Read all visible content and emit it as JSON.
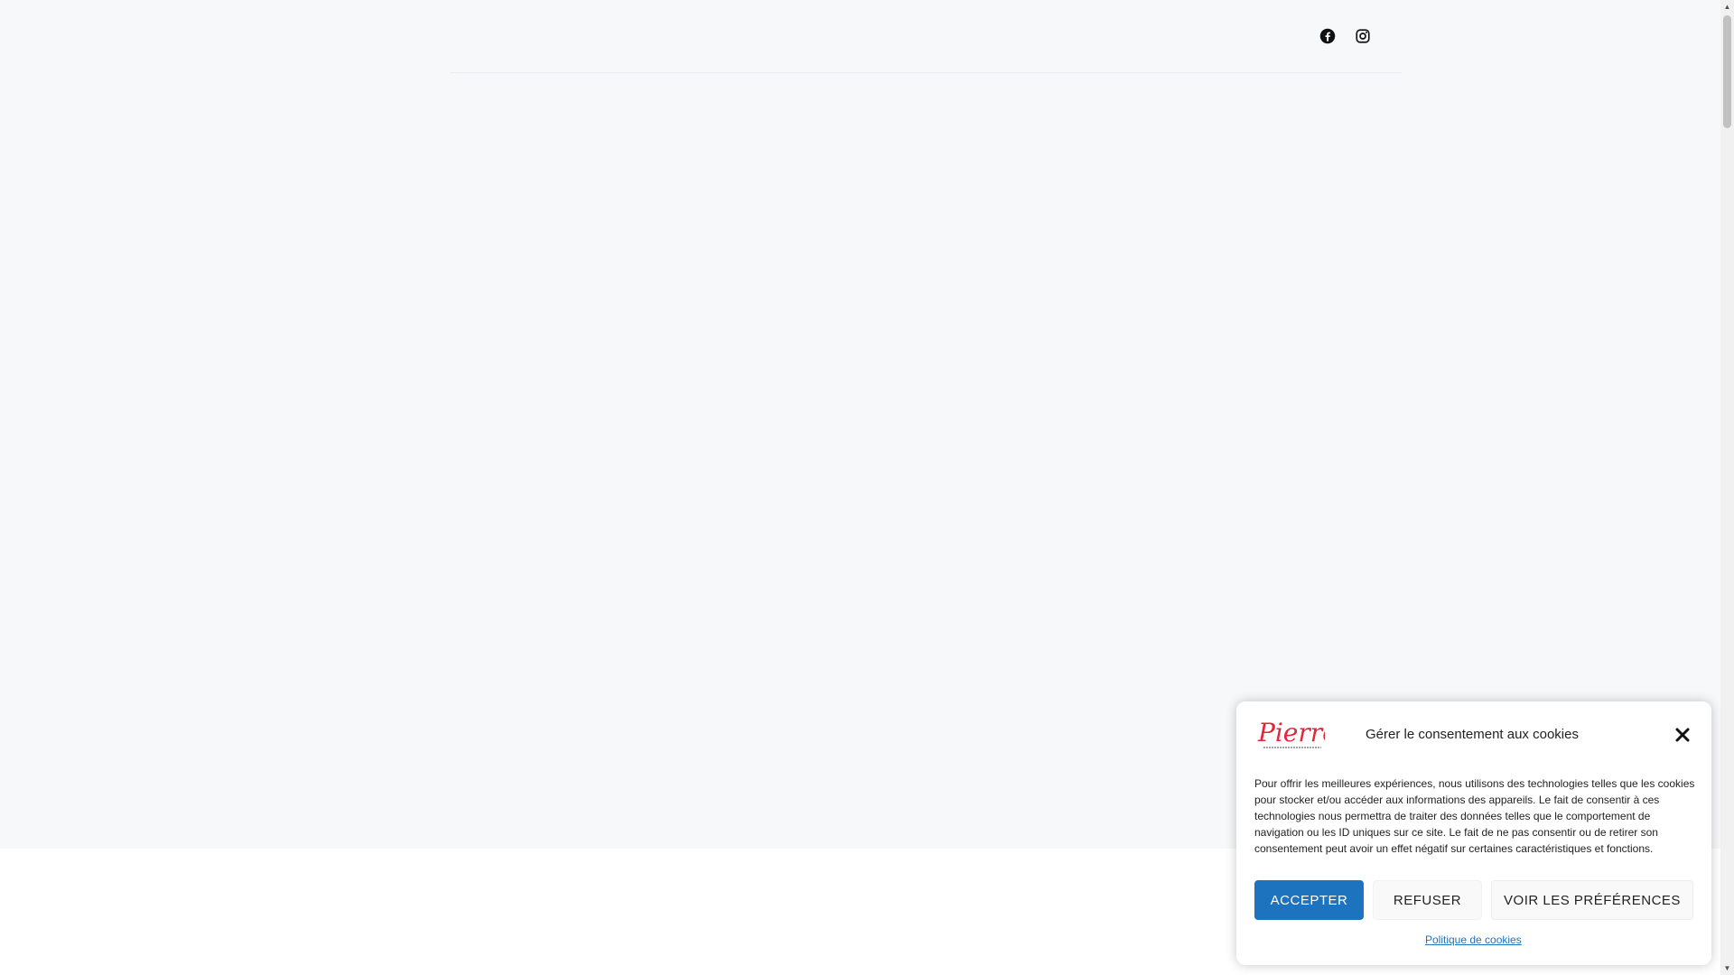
{
  "header": {
    "social": [
      {
        "name": "facebook",
        "icon": "facebook-icon"
      },
      {
        "name": "instagram",
        "icon": "instagram-icon"
      }
    ]
  },
  "cookie_banner": {
    "logo_text": "Pierre",
    "title": "Gérer le consentement aux cookies",
    "body": "Pour offrir les meilleures expériences, nous utilisons des technologies telles que les cookies pour stocker et/ou accéder aux informations des appareils. Le fait de consentir à ces technologies nous permettra de traiter des données telles que le comportement de navigation ou les ID uniques sur ce site. Le fait de ne pas consentir ou de retirer son consentement peut avoir un effet négatif sur certaines caractéristiques et fonctions.",
    "accept_label": "ACCEPTER",
    "refuse_label": "REFUSER",
    "preferences_label": "VOIR LES PRÉFÉRENCES",
    "policy_link": "Politique de cookies",
    "colors": {
      "accent": "#1e73be",
      "logo": "#e2263c"
    }
  }
}
